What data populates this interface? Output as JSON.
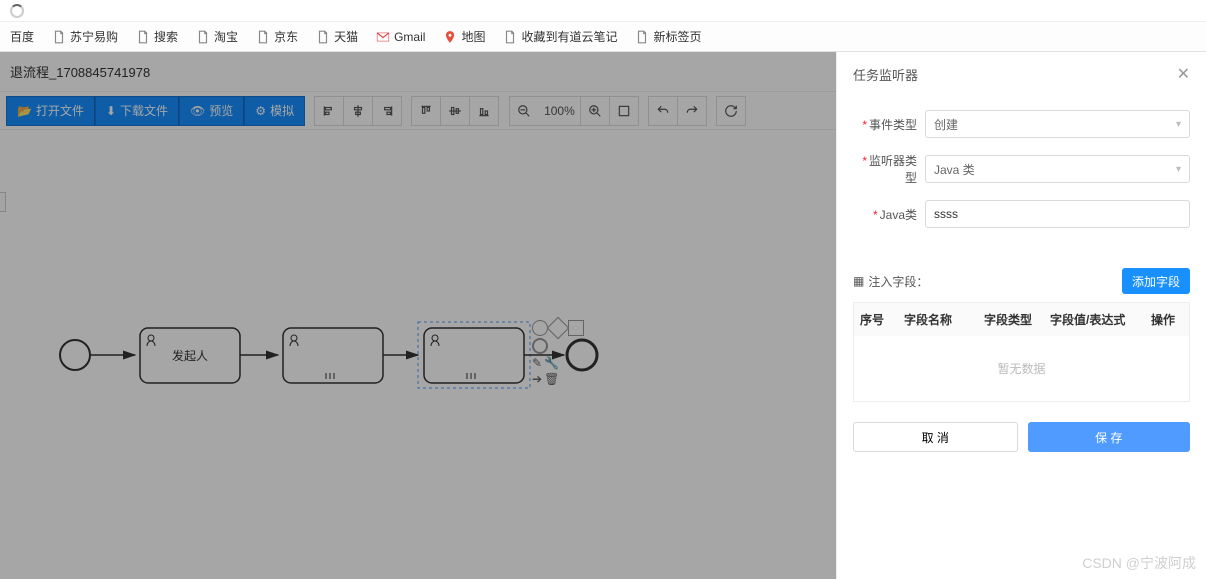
{
  "bookmarks": {
    "baidu": "百度",
    "suning": "苏宁易购",
    "search": "搜索",
    "taobao": "淘宝",
    "jd": "京东",
    "tmall": "天猫",
    "gmail": "Gmail",
    "map": "地图",
    "youdao": "收藏到有道云笔记",
    "newtab": "新标签页"
  },
  "page": {
    "title": "退流程_1708845741978"
  },
  "toolbar": {
    "open": "打开文件",
    "download": "下载文件",
    "preview": "预览",
    "simulate": "模拟",
    "zoom": "100%"
  },
  "diagram": {
    "task1_label": "发起人"
  },
  "panel": {
    "title": "任务监听器",
    "event_type_label": "事件类型",
    "event_type_value": "创建",
    "listener_type_label": "监听器类型",
    "listener_type_value": "Java 类",
    "java_class_label": "Java类",
    "java_class_value": "ssss",
    "inject_label": "注入字段：",
    "add_field": "添加字段",
    "table": {
      "col_index": "序号",
      "col_name": "字段名称",
      "col_type": "字段类型",
      "col_value": "字段值/表达式",
      "col_action": "操作",
      "empty": "暂无数据"
    },
    "cancel": "取 消",
    "save": "保 存"
  },
  "watermark": "CSDN @宁波阿成"
}
